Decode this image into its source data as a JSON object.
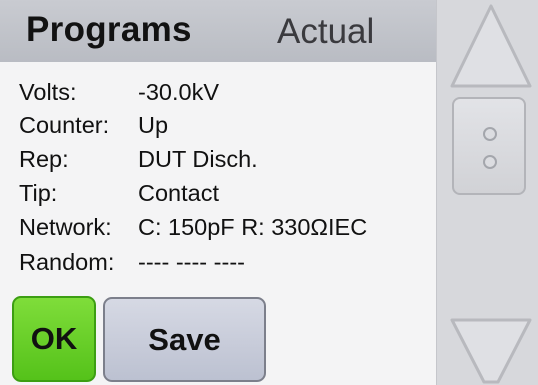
{
  "header": {
    "title": "Programs",
    "mode": "Actual"
  },
  "rows": [
    {
      "label": "Volts:",
      "value": "-30.0kV"
    },
    {
      "label": "Counter:",
      "value": "Up"
    },
    {
      "label": "Rep:",
      "value": "DUT Disch."
    },
    {
      "label": "Tip:",
      "value": "Contact"
    },
    {
      "label": "Network:",
      "value": "C: 150pF R: 330ΩIEC"
    },
    {
      "label": "Random:",
      "value": "---- ---- ----"
    }
  ],
  "buttons": {
    "ok_label": "OK",
    "save_label": "Save"
  },
  "colors": {
    "ok_button": "#55c21a",
    "save_button": "#c4c8d6",
    "header_bg": "#c1c3c9"
  },
  "icons": {
    "scroll_up": "triangle-up-icon",
    "scroll_thumb": "scroll-grip-icon",
    "scroll_down": "triangle-down-icon"
  }
}
